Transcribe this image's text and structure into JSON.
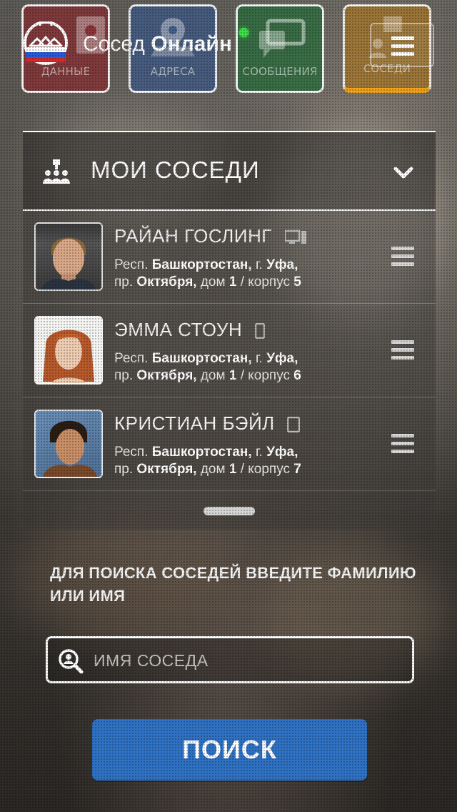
{
  "app": {
    "title_light": "Сосед",
    "title_bold": "Онлайн"
  },
  "tiles": [
    {
      "label": "ДАННЫЕ",
      "icon": "contacts-icon"
    },
    {
      "label": "АДРЕСА",
      "icon": "map-pin-icon"
    },
    {
      "label": "СООБЩЕНИЯ",
      "icon": "chat-bubbles-icon"
    },
    {
      "label": "СОСЕДИ",
      "icon": "neighbors-icon"
    }
  ],
  "section": {
    "title": "МОИ СОСЕДИ"
  },
  "neighbors": [
    {
      "name": "РАЙАН ГОСЛИНГ",
      "device": "desktop-icon",
      "addr1_pre": "Респ.",
      "addr1_region": "Башкортостан,",
      "addr1_mid": "г.",
      "addr1_city": "Уфа,",
      "addr2_pre": "пр.",
      "addr2_street": "Октября,",
      "addr2_house_label": "дом",
      "addr2_house": "1",
      "addr2_sep": " / корпус ",
      "addr2_building": "5"
    },
    {
      "name": "ЭММА СТОУН",
      "device": "mobile-icon",
      "addr1_pre": "Респ.",
      "addr1_region": "Башкортостан,",
      "addr1_mid": "г.",
      "addr1_city": "Уфа,",
      "addr2_pre": "пр.",
      "addr2_street": "Октября,",
      "addr2_house_label": "дом",
      "addr2_house": "1",
      "addr2_sep": " / корпус ",
      "addr2_building": "6"
    },
    {
      "name": "КРИСТИАН БЭЙЛ",
      "device": "tablet-icon",
      "addr1_pre": "Респ.",
      "addr1_region": "Башкортостан,",
      "addr1_mid": "г.",
      "addr1_city": "Уфа,",
      "addr2_pre": "пр.",
      "addr2_street": "Октября,",
      "addr2_house_label": "дом",
      "addr2_house": "1",
      "addr2_sep": " / корпус ",
      "addr2_building": "7"
    }
  ],
  "search": {
    "hint": "ДЛЯ ПОИСКА СОСЕДЕЙ ВВЕДИТЕ ФАМИЛИЮ ИЛИ ИМЯ",
    "placeholder": "ИМЯ СОСЕДА",
    "value": "",
    "button": "ПОИСК"
  },
  "colors": {
    "accent_blue": "#2f72c4",
    "online_green": "#3ee04a",
    "tile_data": "#8c2d30",
    "tile_addresses": "#3c5a8c",
    "tile_messages": "#2a6e3c",
    "tile_neighbors": "#aa7828",
    "tile_neighbors_underline": "#f0a21a"
  }
}
